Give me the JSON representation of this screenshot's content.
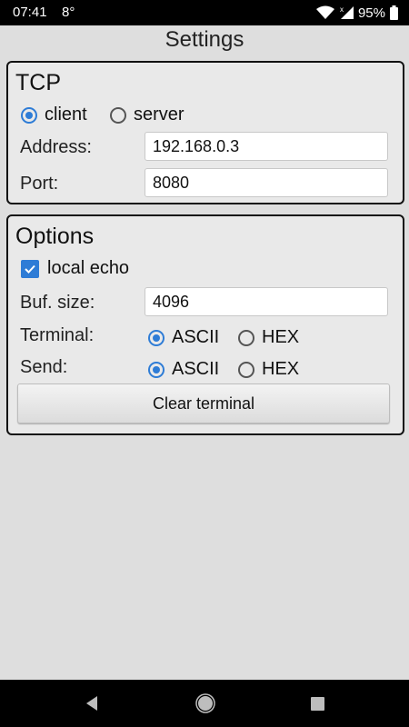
{
  "status_bar": {
    "time": "07:41",
    "temperature": "8°",
    "battery": "95%",
    "icons": [
      "wifi-icon",
      "signal-icon",
      "battery-icon"
    ]
  },
  "page": {
    "title": "Settings"
  },
  "tcp": {
    "title": "TCP",
    "mode_options": [
      "client",
      "server"
    ],
    "mode_selected": "client",
    "address_label": "Address:",
    "address_value": "192.168.0.3",
    "port_label": "Port:",
    "port_value": "8080"
  },
  "options": {
    "title": "Options",
    "local_echo_label": "local echo",
    "local_echo_checked": true,
    "buf_size_label": "Buf. size:",
    "buf_size_value": "4096",
    "terminal_label": "Terminal:",
    "terminal_options": [
      "ASCII",
      "HEX"
    ],
    "terminal_selected": "ASCII",
    "send_label": "Send:",
    "send_options": [
      "ASCII",
      "HEX"
    ],
    "send_selected": "ASCII",
    "clear_button_label": "Clear terminal"
  },
  "nav_bar": {
    "icons": [
      "back-icon",
      "home-icon",
      "recents-icon"
    ]
  },
  "colors": {
    "accent": "#2e7cd6",
    "background": "#dedede"
  }
}
